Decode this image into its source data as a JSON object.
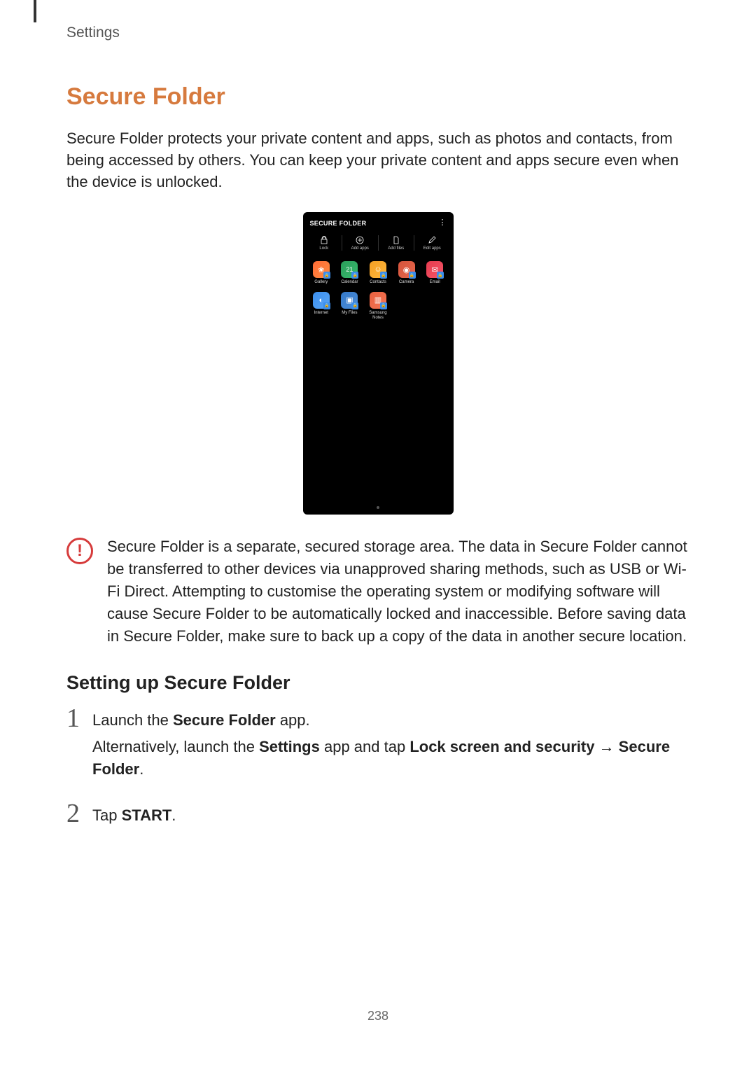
{
  "breadcrumb": "Settings",
  "section_title": "Secure Folder",
  "intro": "Secure Folder protects your private content and apps, such as photos and contacts, from being accessed by others. You can keep your private content and apps secure even when the device is unlocked.",
  "mockup": {
    "title": "SECURE FOLDER",
    "actions": [
      {
        "icon": "lock",
        "label": "Lock"
      },
      {
        "icon": "plus",
        "label": "Add apps"
      },
      {
        "icon": "file",
        "label": "Add files"
      },
      {
        "icon": "pencil",
        "label": "Edit apps"
      }
    ],
    "apps": [
      {
        "name": "Gallery",
        "icon_class": "gallery-icon",
        "glyph": "❀"
      },
      {
        "name": "Calendar",
        "icon_class": "calendar-icon",
        "glyph": "21"
      },
      {
        "name": "Contacts",
        "icon_class": "contacts-icon",
        "glyph": "☺"
      },
      {
        "name": "Camera",
        "icon_class": "camera-icon",
        "glyph": "◉"
      },
      {
        "name": "Email",
        "icon_class": "email-icon",
        "glyph": "✉"
      },
      {
        "name": "Internet",
        "icon_class": "internet-icon",
        "glyph": "◐"
      },
      {
        "name": "My Files",
        "icon_class": "myfiles-icon",
        "glyph": "▣"
      },
      {
        "name": "Samsung Notes",
        "icon_class": "notes-icon",
        "glyph": "▥"
      }
    ]
  },
  "callout": "Secure Folder is a separate, secured storage area. The data in Secure Folder cannot be transferred to other devices via unapproved sharing methods, such as USB or Wi-Fi Direct. Attempting to customise the operating system or modifying software will cause Secure Folder to be automatically locked and inaccessible. Before saving data in Secure Folder, make sure to back up a copy of the data in another secure location.",
  "subsection_title": "Setting up Secure Folder",
  "steps": [
    {
      "num": "1",
      "line1_pre": "Launch the ",
      "line1_b": "Secure Folder",
      "line1_post": " app.",
      "line2_pre": "Alternatively, launch the ",
      "line2_b1": "Settings",
      "line2_mid": " app and tap ",
      "line2_b2": "Lock screen and security",
      "line2_arrow": " → ",
      "line2_b3": "Secure Folder",
      "line2_post": "."
    },
    {
      "num": "2",
      "line1_pre": "Tap ",
      "line1_b": "START",
      "line1_post": "."
    }
  ],
  "page_number": "238"
}
